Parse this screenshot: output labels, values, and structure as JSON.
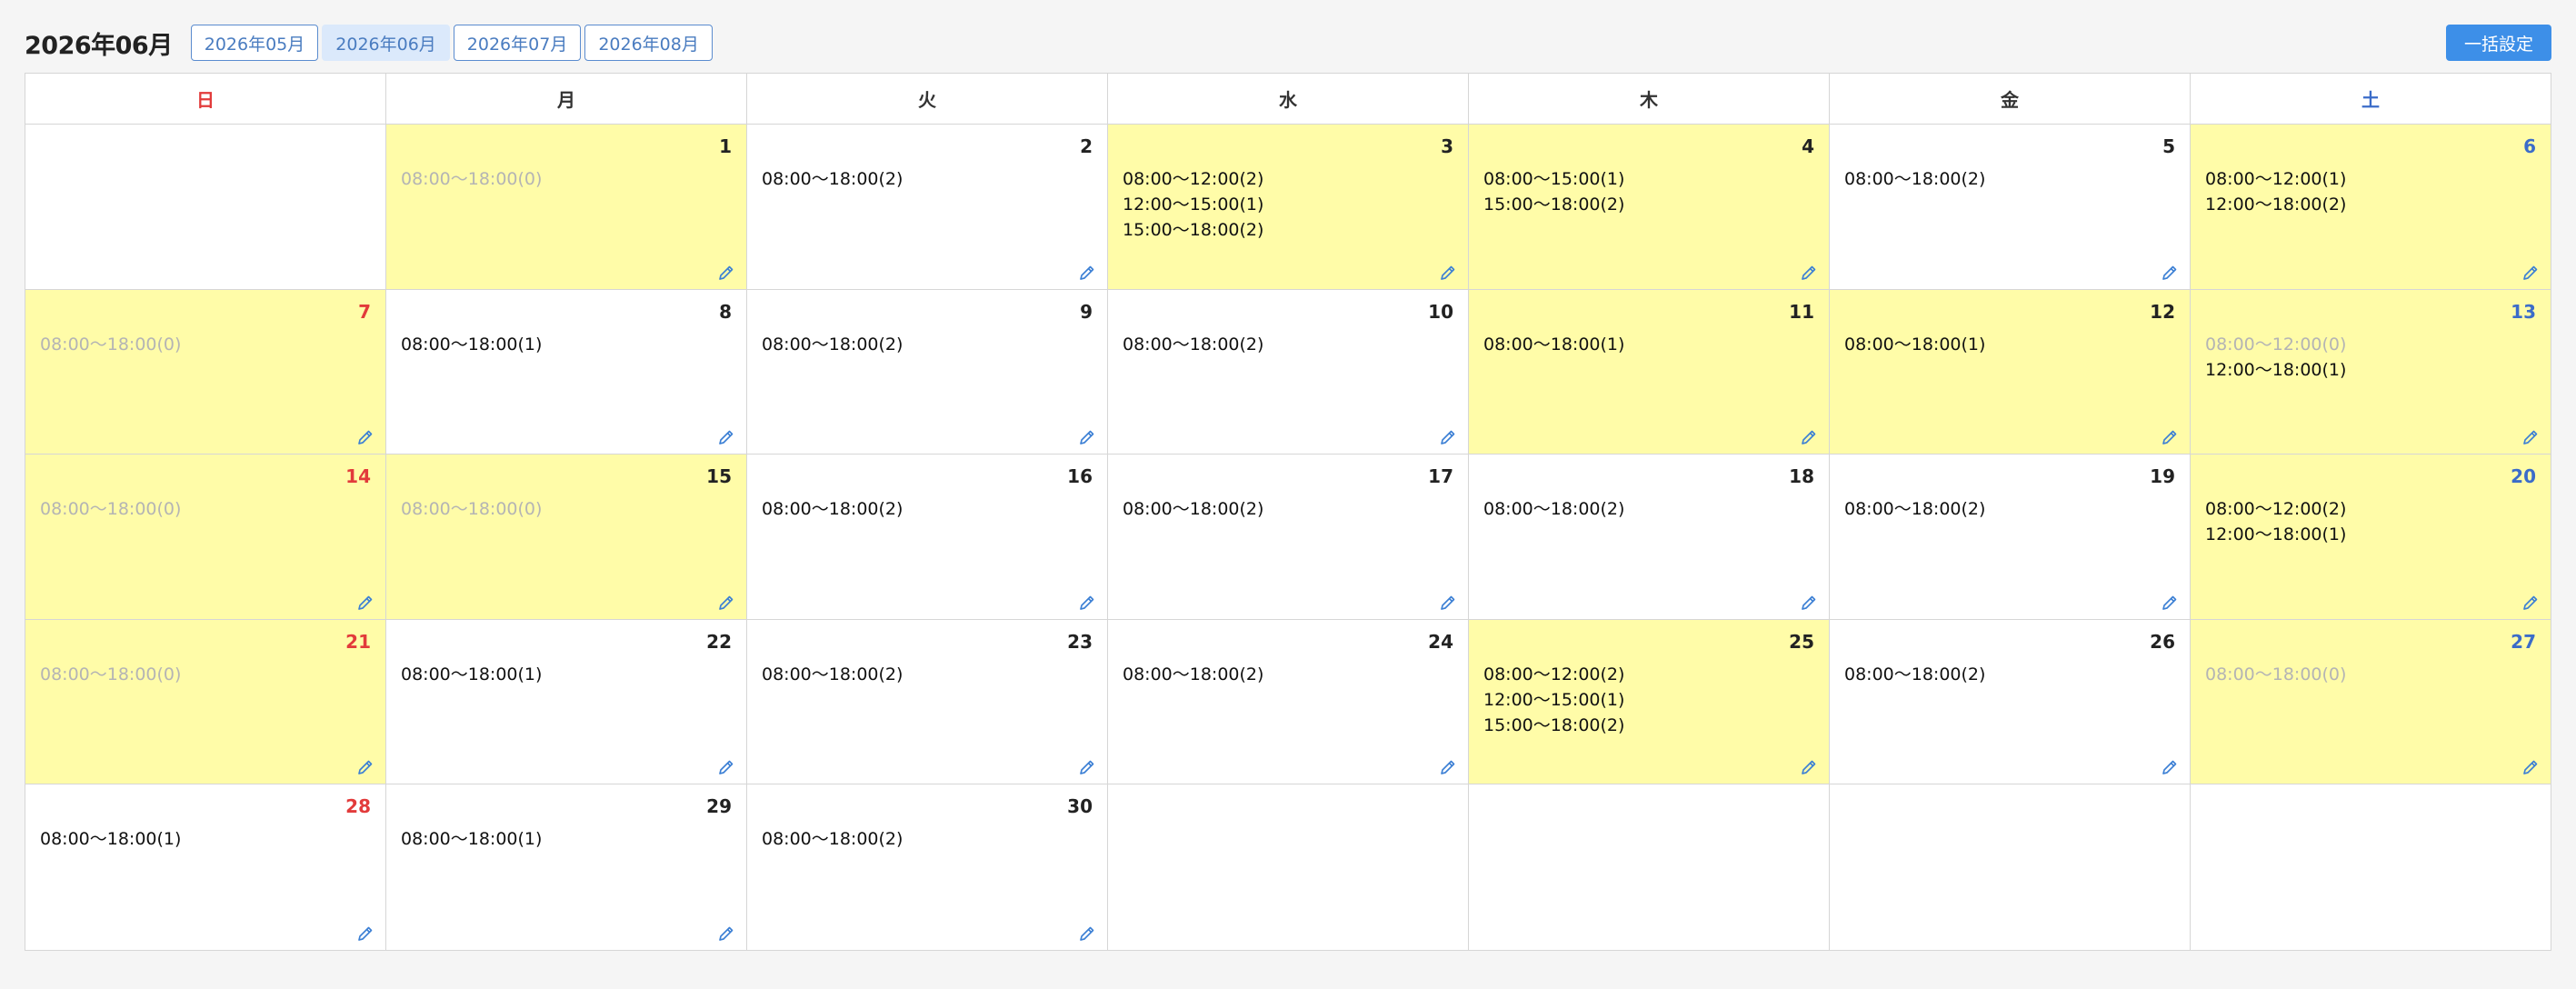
{
  "title": "2026年06月",
  "months": [
    {
      "label": "2026年05月",
      "active": false
    },
    {
      "label": "2026年06月",
      "active": true
    },
    {
      "label": "2026年07月",
      "active": false
    },
    {
      "label": "2026年08月",
      "active": false
    }
  ],
  "bulk_label": "一括設定",
  "weekdays": [
    "日",
    "月",
    "火",
    "水",
    "木",
    "金",
    "土"
  ],
  "colors": {
    "sunday": "#e23b3b",
    "saturday": "#3b6cc9",
    "highlight": "#fffca8",
    "accent": "#3d8fe8"
  },
  "weeks": [
    [
      null,
      {
        "day": "1",
        "hl": true,
        "slots": [
          {
            "t": "08:00〜18:00(0)",
            "zero": true
          }
        ]
      },
      {
        "day": "2",
        "hl": false,
        "slots": [
          {
            "t": "08:00〜18:00(2)",
            "zero": false
          }
        ]
      },
      {
        "day": "3",
        "hl": true,
        "slots": [
          {
            "t": "08:00〜12:00(2)",
            "zero": false
          },
          {
            "t": "12:00〜15:00(1)",
            "zero": false
          },
          {
            "t": "15:00〜18:00(2)",
            "zero": false
          }
        ]
      },
      {
        "day": "4",
        "hl": true,
        "slots": [
          {
            "t": "08:00〜15:00(1)",
            "zero": false
          },
          {
            "t": "15:00〜18:00(2)",
            "zero": false
          }
        ]
      },
      {
        "day": "5",
        "hl": false,
        "slots": [
          {
            "t": "08:00〜18:00(2)",
            "zero": false
          }
        ]
      },
      {
        "day": "6",
        "hl": true,
        "slots": [
          {
            "t": "08:00〜12:00(1)",
            "zero": false
          },
          {
            "t": "12:00〜18:00(2)",
            "zero": false
          }
        ]
      }
    ],
    [
      {
        "day": "7",
        "hl": true,
        "slots": [
          {
            "t": "08:00〜18:00(0)",
            "zero": true
          }
        ]
      },
      {
        "day": "8",
        "hl": false,
        "slots": [
          {
            "t": "08:00〜18:00(1)",
            "zero": false
          }
        ]
      },
      {
        "day": "9",
        "hl": false,
        "slots": [
          {
            "t": "08:00〜18:00(2)",
            "zero": false
          }
        ]
      },
      {
        "day": "10",
        "hl": false,
        "slots": [
          {
            "t": "08:00〜18:00(2)",
            "zero": false
          }
        ]
      },
      {
        "day": "11",
        "hl": true,
        "slots": [
          {
            "t": "08:00〜18:00(1)",
            "zero": false
          }
        ]
      },
      {
        "day": "12",
        "hl": true,
        "slots": [
          {
            "t": "08:00〜18:00(1)",
            "zero": false
          }
        ]
      },
      {
        "day": "13",
        "hl": true,
        "slots": [
          {
            "t": "08:00〜12:00(0)",
            "zero": true
          },
          {
            "t": "12:00〜18:00(1)",
            "zero": false
          }
        ]
      }
    ],
    [
      {
        "day": "14",
        "hl": true,
        "slots": [
          {
            "t": "08:00〜18:00(0)",
            "zero": true
          }
        ]
      },
      {
        "day": "15",
        "hl": true,
        "slots": [
          {
            "t": "08:00〜18:00(0)",
            "zero": true
          }
        ]
      },
      {
        "day": "16",
        "hl": false,
        "slots": [
          {
            "t": "08:00〜18:00(2)",
            "zero": false
          }
        ]
      },
      {
        "day": "17",
        "hl": false,
        "slots": [
          {
            "t": "08:00〜18:00(2)",
            "zero": false
          }
        ]
      },
      {
        "day": "18",
        "hl": false,
        "slots": [
          {
            "t": "08:00〜18:00(2)",
            "zero": false
          }
        ]
      },
      {
        "day": "19",
        "hl": false,
        "slots": [
          {
            "t": "08:00〜18:00(2)",
            "zero": false
          }
        ]
      },
      {
        "day": "20",
        "hl": true,
        "slots": [
          {
            "t": "08:00〜12:00(2)",
            "zero": false
          },
          {
            "t": "12:00〜18:00(1)",
            "zero": false
          }
        ]
      }
    ],
    [
      {
        "day": "21",
        "hl": true,
        "slots": [
          {
            "t": "08:00〜18:00(0)",
            "zero": true
          }
        ]
      },
      {
        "day": "22",
        "hl": false,
        "slots": [
          {
            "t": "08:00〜18:00(1)",
            "zero": false
          }
        ]
      },
      {
        "day": "23",
        "hl": false,
        "slots": [
          {
            "t": "08:00〜18:00(2)",
            "zero": false
          }
        ]
      },
      {
        "day": "24",
        "hl": false,
        "slots": [
          {
            "t": "08:00〜18:00(2)",
            "zero": false
          }
        ]
      },
      {
        "day": "25",
        "hl": true,
        "slots": [
          {
            "t": "08:00〜12:00(2)",
            "zero": false
          },
          {
            "t": "12:00〜15:00(1)",
            "zero": false
          },
          {
            "t": "15:00〜18:00(2)",
            "zero": false
          }
        ]
      },
      {
        "day": "26",
        "hl": false,
        "slots": [
          {
            "t": "08:00〜18:00(2)",
            "zero": false
          }
        ]
      },
      {
        "day": "27",
        "hl": true,
        "slots": [
          {
            "t": "08:00〜18:00(0)",
            "zero": true
          }
        ]
      }
    ],
    [
      {
        "day": "28",
        "hl": false,
        "slots": [
          {
            "t": "08:00〜18:00(1)",
            "zero": false
          }
        ]
      },
      {
        "day": "29",
        "hl": false,
        "slots": [
          {
            "t": "08:00〜18:00(1)",
            "zero": false
          }
        ]
      },
      {
        "day": "30",
        "hl": false,
        "slots": [
          {
            "t": "08:00〜18:00(2)",
            "zero": false
          }
        ]
      },
      null,
      null,
      null,
      null
    ]
  ]
}
